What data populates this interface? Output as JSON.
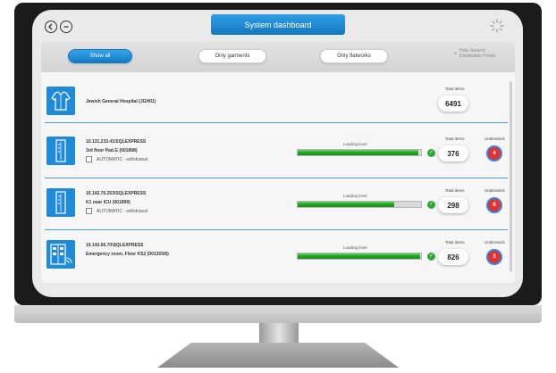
{
  "header": {
    "back_icon": "back-circle-icon",
    "close_icon": "minus-circle-icon",
    "title": "System dashboard",
    "loading_icon": "spinner-icon"
  },
  "filters": {
    "show_all": "Show all",
    "only_garments": "Only garments",
    "only_flatworks": "Only flatworks",
    "hide_generic_line1": "Hide Generic",
    "hide_generic_line2": "Distribution Points"
  },
  "hospital": {
    "name": "Jewish General Hospital (JGH01)",
    "total_label": "Total items",
    "total": "6491",
    "icon": "garment-icon"
  },
  "units": [
    {
      "ip": "10.131.233.41\\SQLEXPRESS",
      "location": "3rd floor Pad.G (001898)",
      "auto": "AUTOMATIC - withdrawal",
      "level_label": "Loading level",
      "level": 0.98,
      "total_label": "Total items",
      "total": "376",
      "understock_label": "Understock",
      "understock": "4",
      "icon": "dispenser-icon"
    },
    {
      "ip": "10.142.76.253\\SQLEXPRESS",
      "location": "K1 near ICU (001899)",
      "auto": "AUTOMATIC - withdrawal",
      "level_label": "Loading level",
      "level": 0.78,
      "total_label": "Total items",
      "total": "298",
      "understock_label": "Understock",
      "understock": "8",
      "icon": "dispenser-icon"
    },
    {
      "ip": "10.142.66.70\\SQLEXPRESS",
      "location": "Emergency room, Floor KS2 (001355/6)",
      "level_label": "Loading level",
      "level": 0.99,
      "total_label": "Total items",
      "total": "826",
      "understock_label": "Understock",
      "understock": "3",
      "icon": "locker-wifi-icon"
    }
  ],
  "colors": {
    "accent": "#1f8ad8",
    "level_fill": "#1ea41e",
    "understock": "#e33030"
  }
}
